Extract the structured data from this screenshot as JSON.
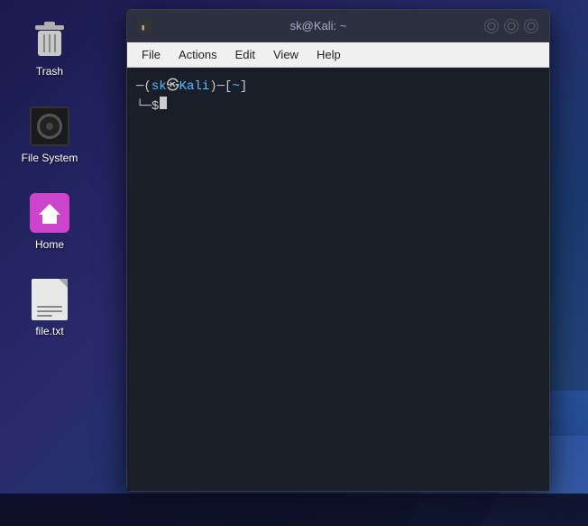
{
  "desktop": {
    "icons": [
      {
        "id": "trash",
        "label": "Trash"
      },
      {
        "id": "filesystem",
        "label": "File System"
      },
      {
        "id": "home",
        "label": "Home"
      },
      {
        "id": "filetxt",
        "label": "file.txt"
      }
    ]
  },
  "terminal": {
    "title": "sk@Kali: ~",
    "window_controls": [
      "minimize",
      "maximize",
      "close"
    ],
    "menu": {
      "items": [
        "File",
        "Actions",
        "Edit",
        "View",
        "Help"
      ]
    },
    "prompt": {
      "bracket_open": "─(",
      "user": "sk",
      "at": "㉿",
      "host": "Kali",
      "bracket_close": ")─[",
      "dir": "~",
      "dir_close": "]",
      "newline_prefix": "└─",
      "dollar": "$"
    }
  }
}
